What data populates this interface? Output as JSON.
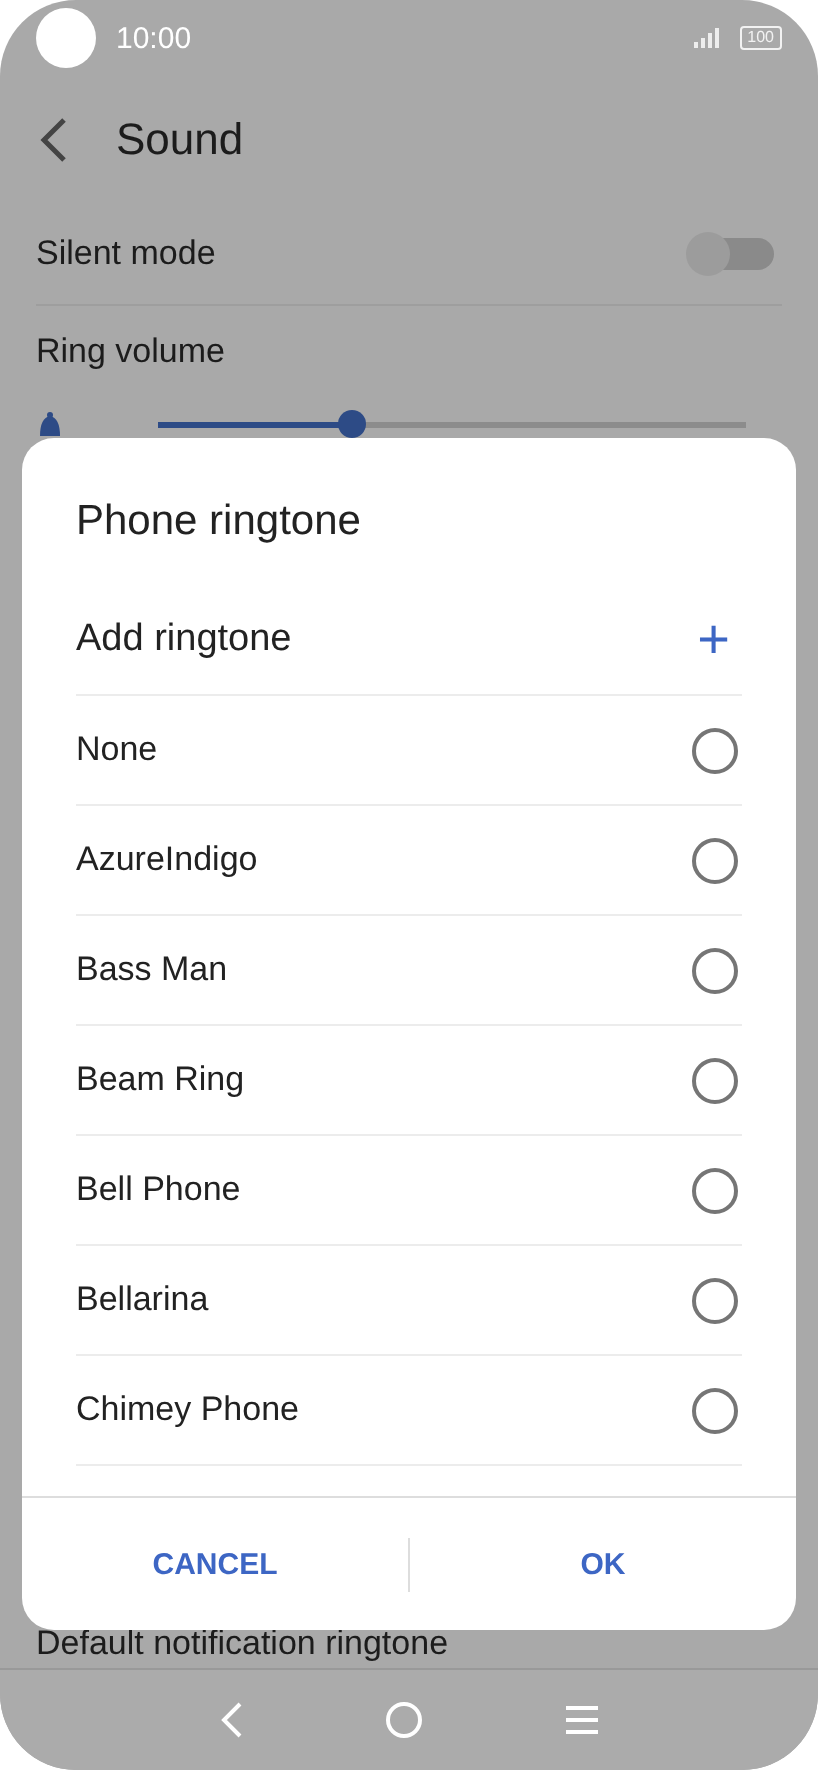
{
  "status_bar": {
    "time": "10:00",
    "battery": "100"
  },
  "header": {
    "title": "Sound"
  },
  "settings": [
    {
      "kind": "toggle",
      "label": "Silent mode",
      "on": false
    },
    {
      "kind": "slider",
      "label": "Ring volume",
      "level": 0.33
    }
  ],
  "partial_setting": {
    "label": "Default notification ringtone"
  },
  "dialog": {
    "title": "Phone ringtone",
    "add_label": "Add ringtone",
    "add_icon": "+",
    "options": [
      {
        "label": "None",
        "selected": false
      },
      {
        "label": "AzureIndigo",
        "selected": false
      },
      {
        "label": "Bass Man",
        "selected": false
      },
      {
        "label": "Beam Ring",
        "selected": false
      },
      {
        "label": "Bell Phone",
        "selected": false
      },
      {
        "label": "Bellarina",
        "selected": false
      },
      {
        "label": "Chimey Phone",
        "selected": false
      }
    ],
    "buttons": [
      "CANCEL",
      "OK"
    ]
  }
}
